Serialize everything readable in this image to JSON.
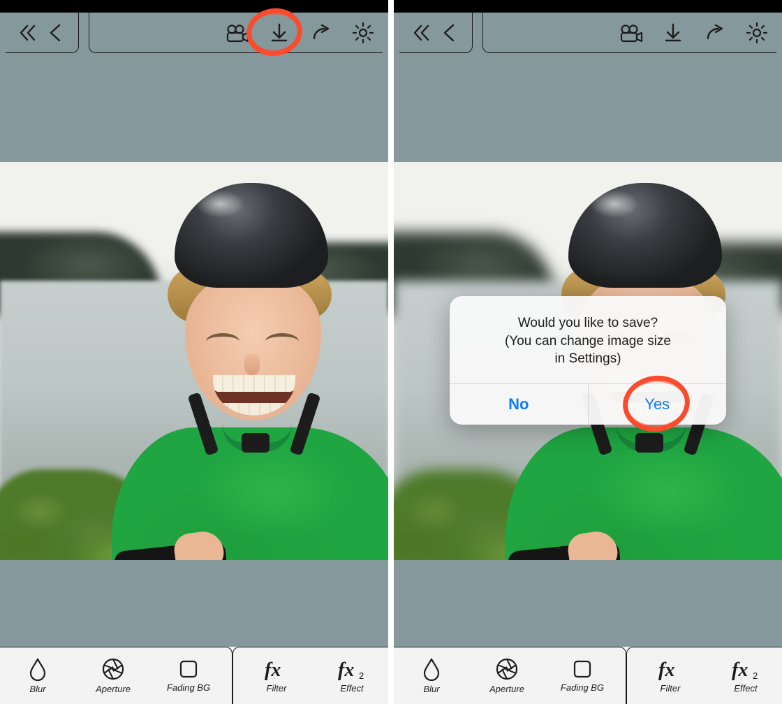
{
  "icons": {
    "back_all": "chevrons-left-icon",
    "back": "chevron-left-icon",
    "camera": "video-camera-icon",
    "download": "download-icon",
    "share": "share-icon",
    "settings": "gear-icon",
    "blur": "droplet-icon",
    "aperture": "aperture-icon",
    "square": "square-icon",
    "fx": "fx-icon",
    "fx2": "fx2-icon"
  },
  "topbar": {
    "camera_label": "Record",
    "download_label": "Save",
    "share_label": "Share",
    "settings_label": "Settings"
  },
  "bottom": {
    "items": [
      {
        "label": "Blur"
      },
      {
        "label": "Aperture"
      },
      {
        "label": "Fading BG"
      },
      {
        "label": "Filter"
      },
      {
        "label": "Effect"
      }
    ]
  },
  "dialog": {
    "line1": "Would you like to save?",
    "line2": "(You can change image size",
    "line3": "in Settings)",
    "no_label": "No",
    "yes_label": "Yes"
  },
  "annotations": {
    "left_target": "download-button",
    "right_target": "dialog-yes-button"
  }
}
